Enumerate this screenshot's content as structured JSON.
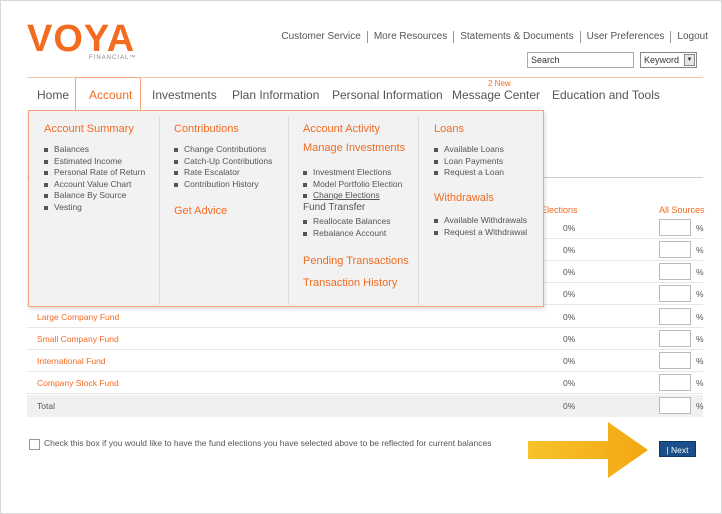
{
  "logo": {
    "word": "VOYA",
    "sub": "FINANCIAL™"
  },
  "utility_links": [
    "Customer Service",
    "More Resources",
    "Statements & Documents",
    "User Preferences",
    "Logout"
  ],
  "search": {
    "value": "Search",
    "keyword_option": "Keyword"
  },
  "nav": {
    "items": [
      "Home",
      "Account",
      "Investments",
      "Plan Information",
      "Personal Information",
      "Message Center",
      "Education and Tools"
    ],
    "active": "Account",
    "message_badge": "2 New"
  },
  "dropdown": {
    "account_summary": {
      "heading": "Account Summary",
      "items": [
        "Balances",
        "Estimated Income",
        "Personal Rate of Return",
        "Account Value Chart",
        "Balance By Source",
        "Vesting"
      ]
    },
    "contributions": {
      "heading": "Contributions",
      "items": [
        "Change Contributions",
        "Catch-Up Contributions",
        "Rate Escalator",
        "Contribution History"
      ],
      "get_advice": "Get Advice"
    },
    "account_activity": {
      "heading": "Account Activity",
      "manage_heading": "Manage Investments",
      "items": [
        "Investment Elections",
        "Model Portfolio Election",
        "Change Elections"
      ],
      "fund_transfer": "Fund Transfer",
      "fund_items": [
        "Reallocate Balances",
        "Rebalance Account"
      ],
      "pending": "Pending Transactions",
      "history": "Transaction History"
    },
    "loans": {
      "heading": "Loans",
      "items": [
        "Available Loans",
        "Loan Payments",
        "Request a Loan"
      ],
      "withdrawals_heading": "Withdrawals",
      "withdrawal_items": [
        "Available Withdrawals",
        "Request a Withdrawal"
      ]
    }
  },
  "table": {
    "col_elections": "Elections",
    "col_sources": "All Sources",
    "hidden_rows": [
      {
        "pct": "0%"
      },
      {
        "pct": "0%"
      },
      {
        "pct": "0%"
      },
      {
        "pct": "0%"
      }
    ],
    "rows": [
      {
        "fund": "Large Company Fund",
        "pct": "0%"
      },
      {
        "fund": "Small Company Fund",
        "pct": "0%"
      },
      {
        "fund": "International Fund",
        "pct": "0%"
      },
      {
        "fund": "Company Stock Fund",
        "pct": "0%"
      }
    ],
    "total": {
      "label": "Total",
      "pct": "0%"
    },
    "percent_symbol": "%"
  },
  "checkbox_text": "Check this box if you would like to have the fund elections you have selected above to be reflected for current balances",
  "next_button": "| Next",
  "colors": {
    "brand_orange": "#f26b21",
    "next_blue": "#1b4f8a",
    "arrow_yellow": "#f5b21b"
  }
}
